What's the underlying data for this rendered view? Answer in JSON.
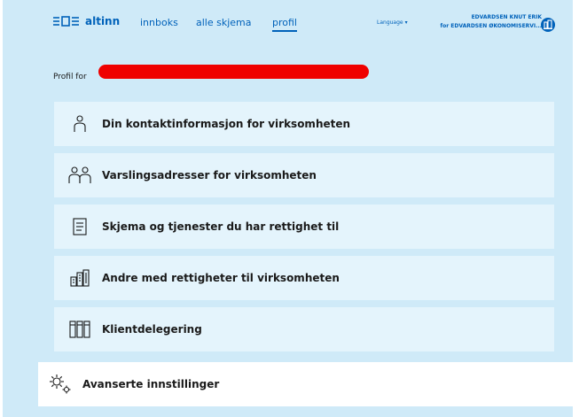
{
  "header": {
    "logo_text": "altinn",
    "nav": [
      {
        "label": "innboks"
      },
      {
        "label": "alle skjema"
      },
      {
        "label": "profil"
      }
    ],
    "language_label": "Language",
    "user_name": "EDVARDSEN KNUT ERIK",
    "user_org": "for EDVARDSEN ØKONOMISERVI..."
  },
  "profile": {
    "prefix": "Profil for"
  },
  "cards": [
    {
      "label": "Din kontaktinformasjon for virksomheten",
      "icon": "person-icon"
    },
    {
      "label": "Varslingsadresser for virksomheten",
      "icon": "people-icon"
    },
    {
      "label": "Skjema og tjenester du har rettighet til",
      "icon": "document-icon"
    },
    {
      "label": "Andre med rettigheter til virksomheten",
      "icon": "building-icon"
    },
    {
      "label": "Klientdelegering",
      "icon": "boxes-icon"
    }
  ],
  "advanced": {
    "label": "Avanserte innstillinger",
    "icon": "gears-icon"
  },
  "colors": {
    "accent": "#0062ba",
    "background": "#cfeaf8",
    "card": "#e4f4fc",
    "redaction": "#ef0000"
  }
}
